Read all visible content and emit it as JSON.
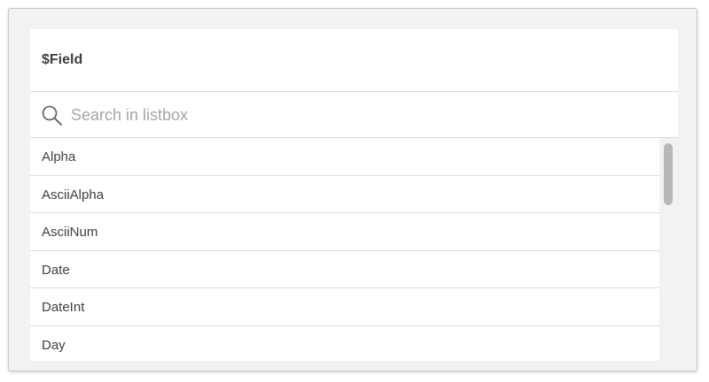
{
  "listbox": {
    "title": "$Field",
    "search": {
      "placeholder": "Search in listbox",
      "value": "",
      "icon": "search-icon"
    },
    "items": [
      {
        "label": "Alpha"
      },
      {
        "label": "AsciiAlpha"
      },
      {
        "label": "AsciiNum"
      },
      {
        "label": "Date"
      },
      {
        "label": "DateInt"
      },
      {
        "label": "Day"
      }
    ]
  },
  "colors": {
    "frame_background": "#f2f2f2",
    "panel_background": "#ffffff",
    "text": "#404040",
    "placeholder": "#a6a6a6",
    "divider": "#d9d9d9",
    "scrollbar_thumb": "#b8b8b8"
  }
}
